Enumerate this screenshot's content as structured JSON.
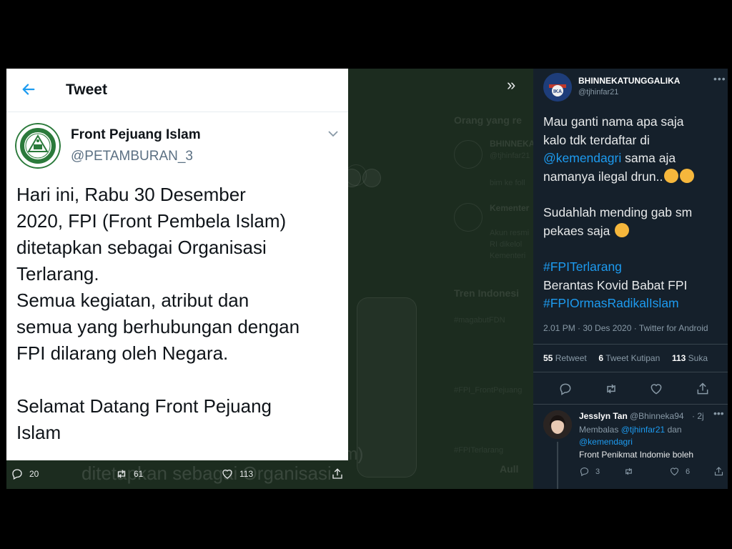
{
  "left_tweet": {
    "header_title": "Tweet",
    "author_name": "Front Pejuang Islam",
    "author_handle": "@PETAMBURAN_3",
    "body": "Hari ini, Rabu 30 Desember\n2020, FPI (Front Pembela Islam)\nditetapkan sebagai Organisasi\nTerlarang.\nSemua kegiatan, atribut dan\nsemua yang berhubungan dengan\nFPI dilarang oleh Negara.\n\nSelamat Datang Front Pejuang\nIslam",
    "actions": {
      "replies": "20",
      "retweets": "61",
      "likes": "113"
    },
    "ghost_text": "ditetapkan sebagai Organisasi",
    "ghost_text2": "am)",
    "icons": [
      "back-arrow-icon",
      "chevron-down-icon",
      "logo"
    ]
  },
  "background_page": {
    "chevrons": "»",
    "items": [
      "Orang yang re",
      "BHINNEKA",
      "Kementer",
      "Tren Indonesi",
      "#magabutFDN",
      "#FPI_FrontPejuang",
      "#FPITerlarang",
      "Aull"
    ]
  },
  "right_tweet": {
    "author_name": "BHINNEKATUNGGALIKA",
    "author_handle": "@tjhinfar21",
    "more": "•••",
    "body_line1": "Mau ganti nama apa saja",
    "body_line2": "kalo tdk terdaftar di",
    "mention": "@kemendagri",
    "body_line3_rest": " sama aja",
    "body_line4": "namanya ilegal drun..",
    "body_line5": "Sudahlah mending gab sm",
    "body_line6": "pekaes saja",
    "hashtag1": "#FPITerlarang",
    "body_line7": "Berantas Kovid Babat FPI",
    "hashtag2": "#FPIOrmasRadikalIslam",
    "meta": "2.01 PM · 30 Des 2020 · Twitter for Android",
    "stats": {
      "retweets_count": "55",
      "retweets_label": "Retweet",
      "quotes_count": "6",
      "quotes_label": "Tweet Kutipan",
      "likes_count": "113",
      "likes_label": "Suka"
    }
  },
  "reply": {
    "name": "Jesslyn Tan",
    "handle": "@Bhinneka94",
    "time": "· 2j",
    "more": "•••",
    "replying_prefix": "Membalas ",
    "replying_to1": "@tjhinfar21",
    "replying_and": " dan",
    "replying_to2": "@kemendagri",
    "text": "Front Penikmat Indomie boleh",
    "actions": {
      "replies": "3",
      "likes": "6"
    }
  },
  "colors": {
    "twitter_blue": "#1d9bf0",
    "dark_bg": "#15202b",
    "dim_green_bg": "#1c2c1f",
    "text_dark": "#0f1419",
    "text_muted": "#5b7083"
  }
}
